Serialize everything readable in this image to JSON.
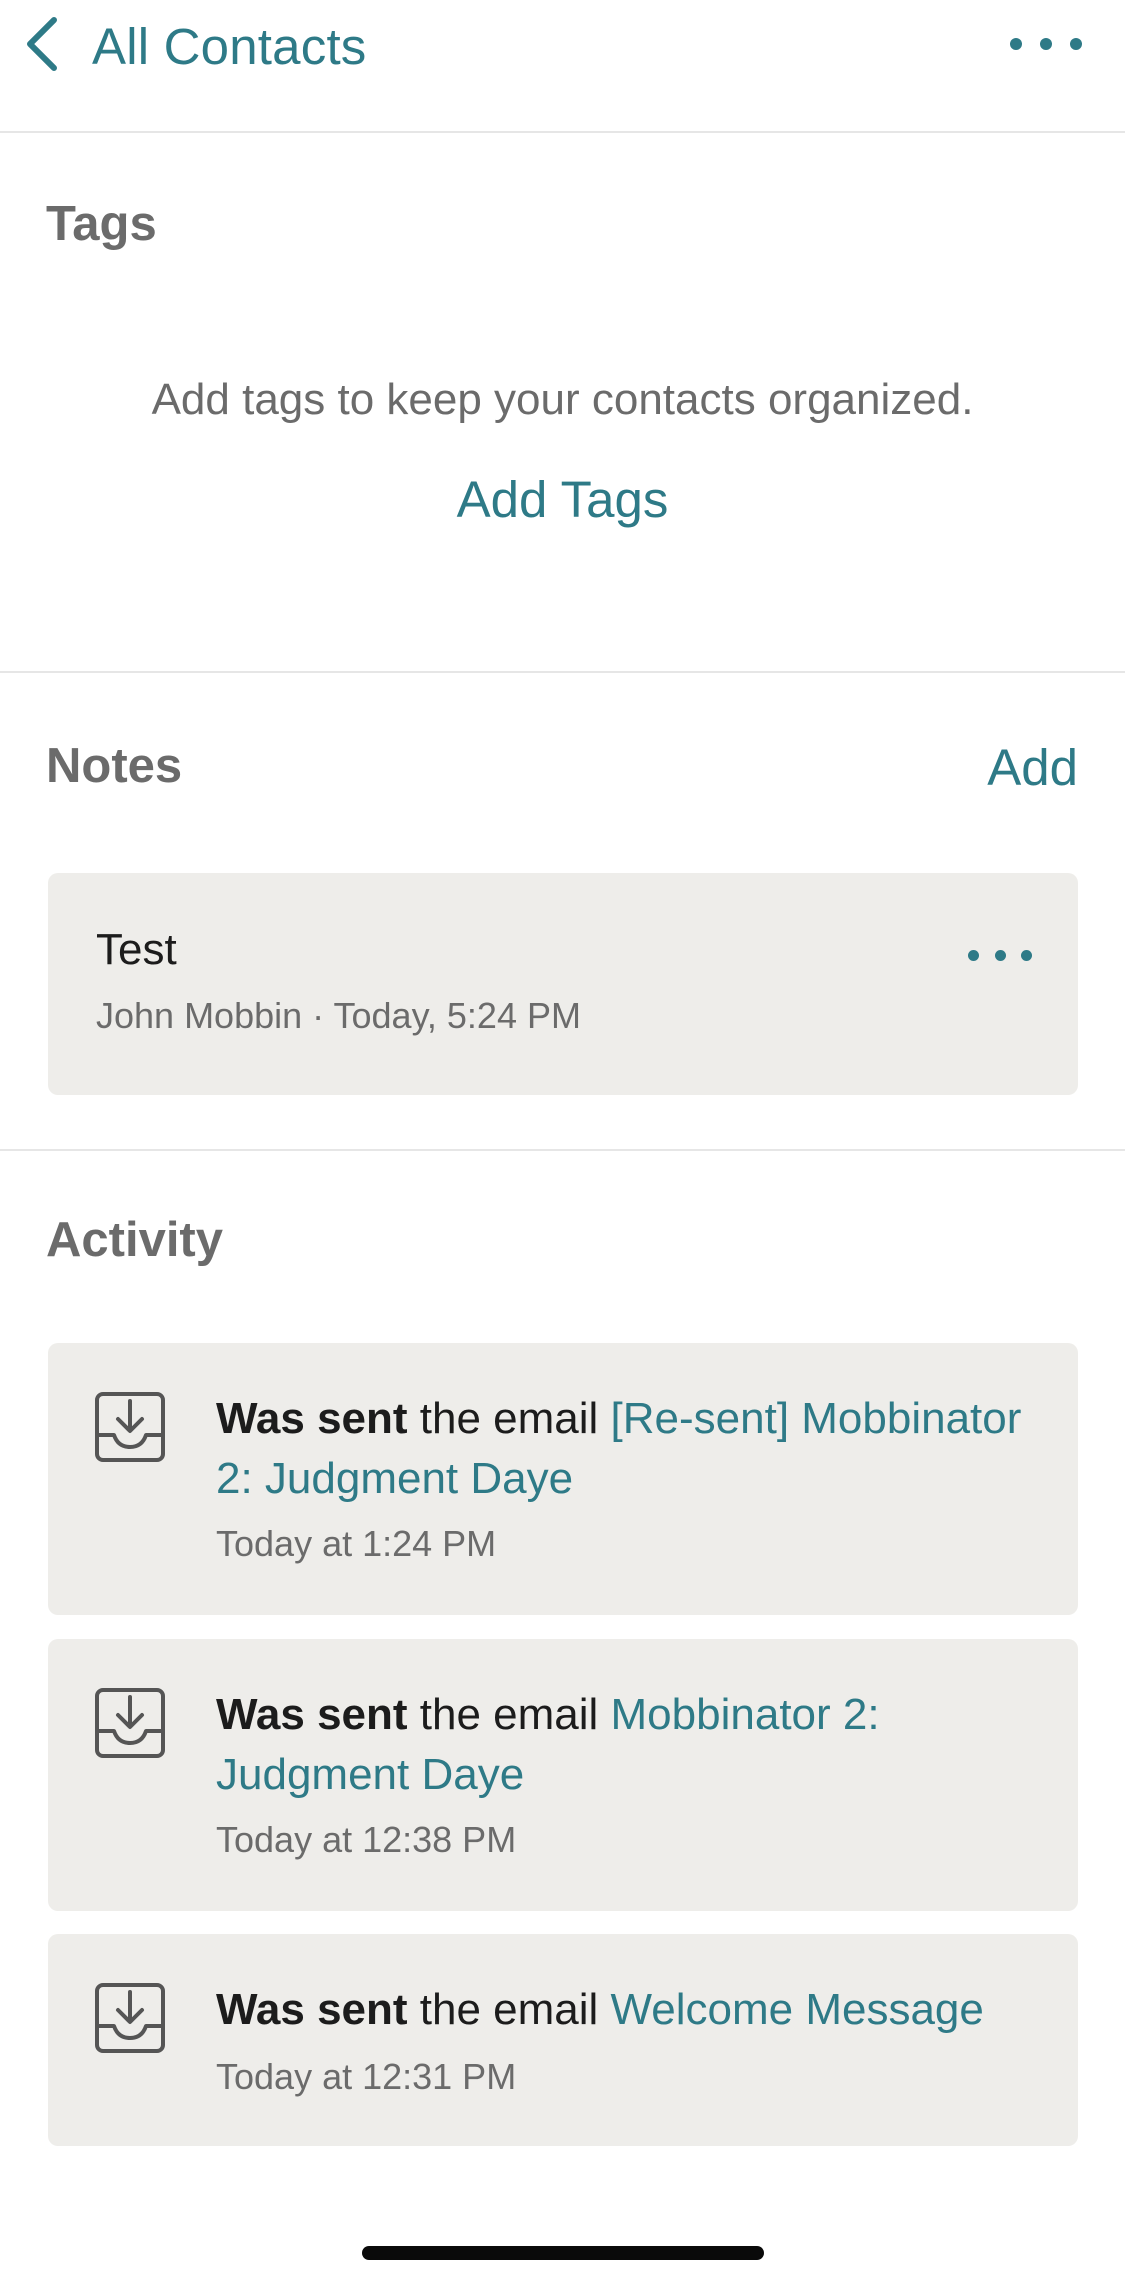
{
  "nav": {
    "back_label": "All Contacts",
    "back_icon": "chevron-left-icon",
    "more_icon": "ellipsis-icon"
  },
  "tags": {
    "title": "Tags",
    "empty_message": "Add tags to keep your contacts organized.",
    "add_label": "Add Tags"
  },
  "notes": {
    "title": "Notes",
    "add_label": "Add",
    "items": [
      {
        "title": "Test",
        "author": "John Mobbin",
        "separator": "·",
        "time": "Today, 5:24 PM"
      }
    ]
  },
  "activity": {
    "title": "Activity",
    "items": [
      {
        "icon": "inbox-download-icon",
        "action": "Was sent",
        "text": " the email ",
        "subject": "[Re-sent] Mobbinator 2: Judgment Daye",
        "time": "Today at 1:24 PM"
      },
      {
        "icon": "inbox-download-icon",
        "action": "Was sent",
        "text": " the email ",
        "subject": "Mobbinator 2: Judgment Daye",
        "time": "Today at 12:38 PM"
      },
      {
        "icon": "inbox-download-icon",
        "action": "Was sent",
        "text": " the email ",
        "subject": "Welcome Message",
        "time": "Today at 12:31 PM"
      }
    ]
  },
  "colors": {
    "accent": "#2e7a87",
    "card_background": "#eeedea",
    "section_title": "#6b6b6b",
    "divider": "#e6e6e6"
  }
}
